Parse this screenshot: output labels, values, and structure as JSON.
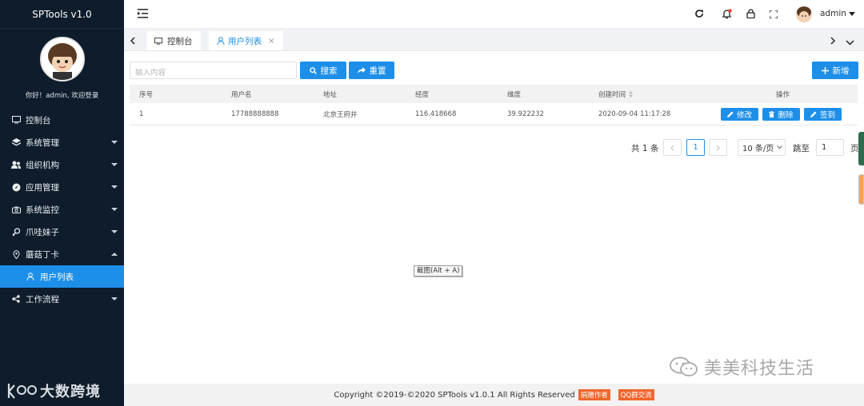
{
  "app": {
    "title": "SPTools v1.0"
  },
  "user": {
    "greeting": "你好！admin, 欢迎登录",
    "name": "admin"
  },
  "sidebar": {
    "items": [
      {
        "label": "控制台",
        "icon": "monitor-icon"
      },
      {
        "label": "系统管理",
        "icon": "layers-icon"
      },
      {
        "label": "组织机构",
        "icon": "users-icon"
      },
      {
        "label": "应用管理",
        "icon": "compass-icon"
      },
      {
        "label": "系统监控",
        "icon": "camera-icon"
      },
      {
        "label": "爪哇妹子",
        "icon": "female-icon"
      },
      {
        "label": "蘑菇丁卡",
        "icon": "location-pin-icon"
      },
      {
        "label": "用户列表",
        "icon": "user-icon",
        "active": true
      },
      {
        "label": "工作流程",
        "icon": "share-icon"
      }
    ],
    "logo_text": "大数跨境"
  },
  "tabs": [
    {
      "label": "控制台",
      "icon": "monitor-icon"
    },
    {
      "label": "用户列表",
      "icon": "user-icon",
      "active": true
    }
  ],
  "toolbar": {
    "search_placeholder": "输入内容",
    "search_label": "搜索",
    "reset_label": "重置",
    "add_label": "新增"
  },
  "table": {
    "columns": [
      "序号",
      "用户名",
      "地址",
      "经度",
      "维度",
      "创建时间",
      "操作"
    ],
    "rows": [
      {
        "id": "1",
        "username": "17788888888",
        "address": "北京王府井",
        "lng": "116.418668",
        "lat": "39.922232",
        "created": "2020-09-04 11:17:28"
      }
    ],
    "actions": {
      "edit": "修改",
      "delete": "删除",
      "signin": "签到"
    }
  },
  "pagination": {
    "total": "共 1 条",
    "current": "1",
    "size": "10 条/页",
    "goto": "跳至",
    "goto_value": "1",
    "page_suffix": "页"
  },
  "tooltip": "截图(Alt + A)",
  "footer": {
    "copyright": "Copyright ©2019-©2020 SPTools v1.0.1 All Rights Reserved",
    "badge1": "捐赠作者",
    "badge2": "QQ群交流"
  },
  "watermark": "美美科技生活",
  "colors": {
    "sidebar_bg": "#0e1c2b",
    "accent": "#1e8fe8",
    "badge": "#f0672e"
  }
}
